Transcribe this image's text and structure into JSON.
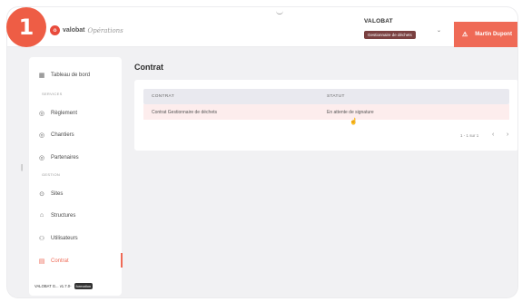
{
  "step_number": "1",
  "header": {
    "logo_text": "valobat",
    "logo_subtitle": "Opérations",
    "org_name": "VALOBAT",
    "org_role": "Gestionnaire de déchets",
    "user_name": "Martin Dupont"
  },
  "sidebar": {
    "dashboard": "Tableau de bord",
    "section_services": "SERVICES",
    "section_gestion": "GESTION",
    "items": [
      {
        "label": "Règlement",
        "icon": "coin-icon"
      },
      {
        "label": "Chantiers",
        "icon": "coin-icon"
      },
      {
        "label": "Partenaires",
        "icon": "coin-icon"
      },
      {
        "label": "Sites",
        "icon": "pin-icon"
      },
      {
        "label": "Structures",
        "icon": "home-icon"
      },
      {
        "label": "Utilisateurs",
        "icon": "users-icon"
      },
      {
        "label": "Contrat",
        "icon": "document-icon",
        "active": true
      }
    ],
    "version": "VALOBAT G... v1.7.0-",
    "env_tag": "formation"
  },
  "main": {
    "title": "Contrat",
    "table": {
      "columns": [
        "CONTRAT",
        "STATUT"
      ],
      "rows": [
        [
          "Contrat Gestionnaire de déchets",
          "En attente de signature"
        ]
      ]
    },
    "pagination": "1 - 1 sur 1"
  },
  "colors": {
    "accent": "#ef6a56",
    "badge": "#ee5d45",
    "role_tag": "#7a4040"
  }
}
